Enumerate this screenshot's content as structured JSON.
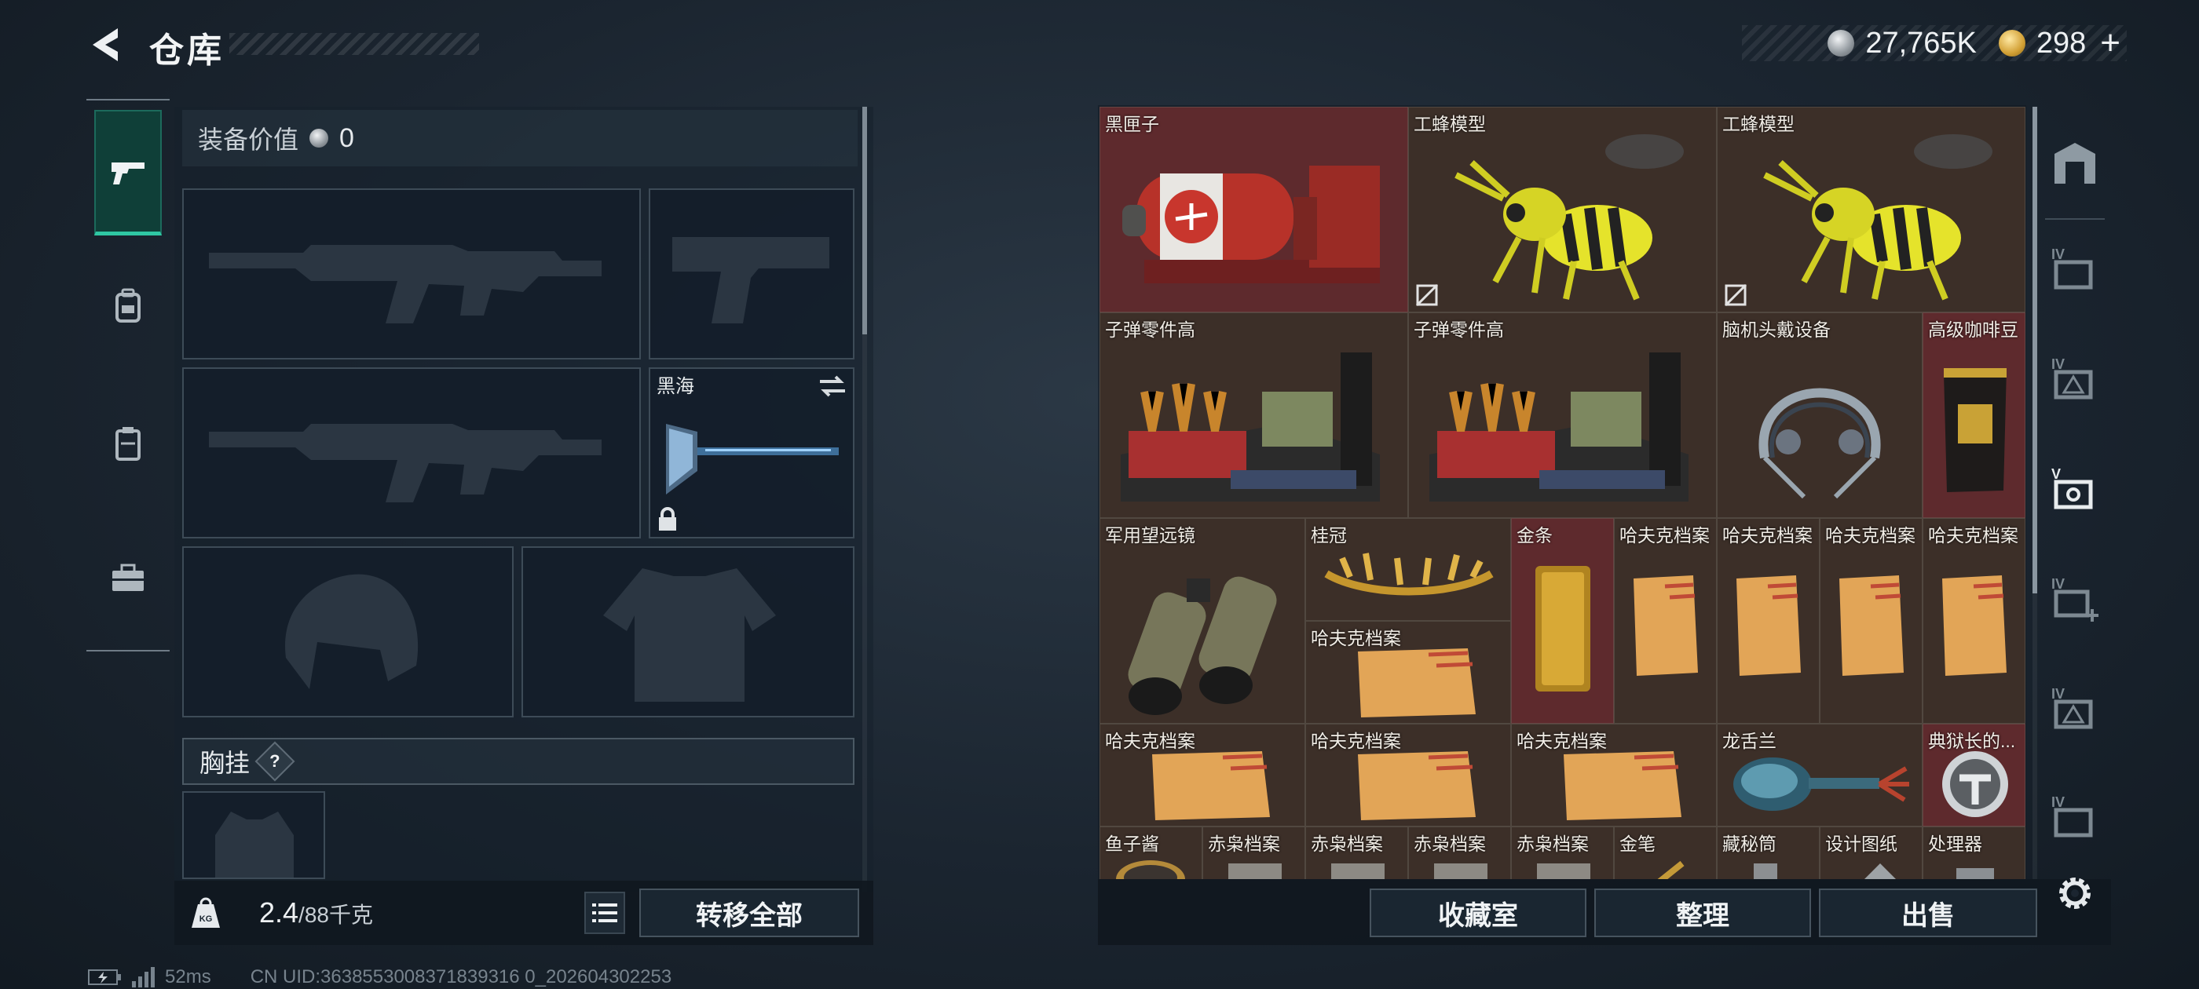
{
  "header": {
    "title": "仓库",
    "currencies": [
      {
        "icon": "silver-coin-icon",
        "value": "27,765K"
      },
      {
        "icon": "gold-coin-icon",
        "value": "298"
      }
    ],
    "plus_label": "+"
  },
  "left_tabs": [
    {
      "icon": "pistol-icon",
      "active": true
    },
    {
      "icon": "backpack-icon",
      "active": false
    },
    {
      "icon": "vest-icon",
      "active": false
    },
    {
      "icon": "toolbox-icon",
      "active": false
    }
  ],
  "loadout": {
    "equip_value_label": "装备价值",
    "equip_value": "0",
    "melee_name": "黑海",
    "chest_rig_label": "胸挂",
    "help_label": "?",
    "weight_current": "2.4",
    "weight_max": "/88千克",
    "transfer_all_label": "转移全部"
  },
  "stash": {
    "items": [
      {
        "label": "黑匣子",
        "bg": "red"
      },
      {
        "label": "工蜂模型",
        "bg": "brown",
        "no_drop": true
      },
      {
        "label": "工蜂模型",
        "bg": "brown",
        "no_drop": true
      },
      {
        "label": "子弹零件高",
        "bg": "brown"
      },
      {
        "label": "子弹零件高",
        "bg": "brown"
      },
      {
        "label": "脑机头戴设备",
        "bg": "brown"
      },
      {
        "label": "高级咖啡豆",
        "bg": "red"
      },
      {
        "label": "军用望远镜",
        "bg": "brown"
      },
      {
        "label": "桂冠",
        "bg": "brown"
      },
      {
        "label": "金条",
        "bg": "red"
      },
      {
        "label": "哈夫克档案",
        "bg": "brown"
      },
      {
        "label": "哈夫克档案",
        "bg": "brown"
      },
      {
        "label": "哈夫克档案",
        "bg": "brown"
      },
      {
        "label": "哈夫克档案",
        "bg": "brown"
      },
      {
        "label": "哈夫克档案",
        "bg": "brown"
      },
      {
        "label": "哈夫克档案",
        "bg": "brown"
      },
      {
        "label": "哈夫克档案",
        "bg": "brown"
      },
      {
        "label": "哈夫克档案",
        "bg": "brown"
      },
      {
        "label": "龙舌兰",
        "bg": "brown"
      },
      {
        "label": "典狱长的...",
        "bg": "red"
      },
      {
        "label": "鱼子酱",
        "bg": "brown"
      },
      {
        "label": "赤枭档案",
        "bg": "brown"
      },
      {
        "label": "赤枭档案",
        "bg": "brown"
      },
      {
        "label": "赤枭档案",
        "bg": "brown"
      },
      {
        "label": "赤枭档案",
        "bg": "brown"
      },
      {
        "label": "金笔",
        "bg": "brown"
      },
      {
        "label": "藏秘筒",
        "bg": "brown"
      },
      {
        "label": "设计图纸",
        "bg": "brown"
      },
      {
        "label": "处理器",
        "bg": "brown"
      }
    ],
    "collection_label": "收藏室",
    "sort_label": "整理",
    "sell_label": "出售"
  },
  "right_tabs": [
    {
      "icon": "vault-icon"
    },
    {
      "icon": "stash-page-4-icon"
    },
    {
      "icon": "stash-page-4-warning-icon"
    },
    {
      "icon": "stash-page-5-icon"
    },
    {
      "icon": "stash-page-4-add-icon"
    },
    {
      "icon": "stash-page-4-warning-icon"
    },
    {
      "icon": "stash-page-4-icon"
    }
  ],
  "status": {
    "ping": "52ms",
    "uid": "CN UID:3638553008371839316 0_202604302253"
  }
}
